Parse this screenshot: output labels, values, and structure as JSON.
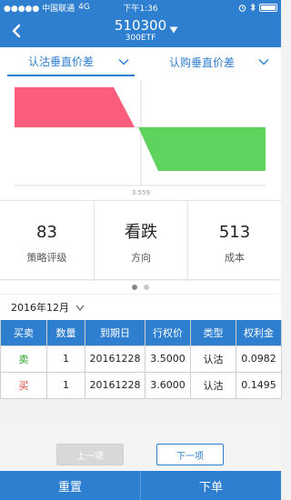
{
  "status_bar": {
    "signal": "●●●●● 中国联通",
    "network": "4G",
    "time": "下午1:36",
    "battery_level": 1.0
  },
  "header": {
    "code": "510300",
    "name": "300ETF",
    "back_icon": "chevron-left-icon",
    "dropdown_icon": "triangle-down-icon"
  },
  "strategy_tabs": [
    {
      "label": "认沽垂直价差",
      "selected": true
    },
    {
      "label": "认购垂直价差",
      "selected": false
    }
  ],
  "chart_data": {
    "type": "area",
    "description_label": "",
    "x_tick": "3.559",
    "series": [
      {
        "color": "#fd5d7c",
        "sign": "positive"
      },
      {
        "color": "#5fd35d",
        "sign": "negative"
      }
    ]
  },
  "metrics": [
    {
      "value": "83",
      "label": "策略评级"
    },
    {
      "value": "看跌",
      "label": "方向"
    },
    {
      "value": "513",
      "label": "成本"
    }
  ],
  "pager": {
    "count": 2,
    "active": 0
  },
  "month_selector": {
    "value": "2016年12月"
  },
  "table": {
    "headers": [
      "买卖",
      "数量",
      "到期日",
      "行权价",
      "类型",
      "权利金"
    ],
    "rows": [
      {
        "side": "卖",
        "side_color": "#2aa52a",
        "qty": "1",
        "expiry": "20161228",
        "strike": "3.5000",
        "type": "认沽",
        "premium": "0.0982"
      },
      {
        "side": "买",
        "side_color": "#e0463f",
        "qty": "1",
        "expiry": "20161228",
        "strike": "3.6000",
        "type": "认沽",
        "premium": "0.1495"
      }
    ]
  },
  "buttons": {
    "prev": "上一项",
    "next": "下一项"
  },
  "footer": {
    "reset": "重置",
    "order": "下单"
  },
  "colors": {
    "accent": "#2f7fd0"
  }
}
